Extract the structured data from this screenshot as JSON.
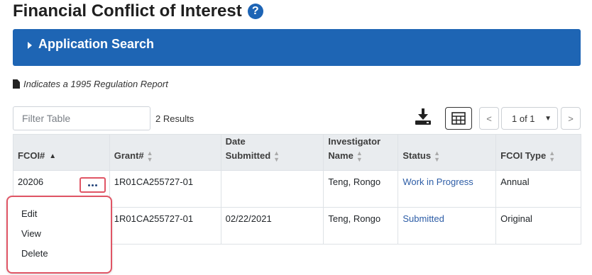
{
  "page": {
    "title": "Financial Conflict of Interest",
    "help_icon": "question-circle-icon"
  },
  "app_search": {
    "label": "Application Search"
  },
  "note": {
    "text": "Indicates a 1995 Regulation Report",
    "icon": "document-icon"
  },
  "toolbar": {
    "filter_placeholder": "Filter Table",
    "results": "2 Results",
    "download_icon": "download-icon",
    "columns_icon": "table-grid-icon",
    "prev": "<",
    "next": ">",
    "page": "1 of 1"
  },
  "table": {
    "headers": [
      {
        "line1": "FCOI#",
        "line2": ""
      },
      {
        "line1": "Grant#",
        "line2": ""
      },
      {
        "line1": "Date",
        "line2": "Submitted"
      },
      {
        "line1": "Investigator",
        "line2": "Name"
      },
      {
        "line1": "Status",
        "line2": ""
      },
      {
        "line1": "FCOI Type",
        "line2": ""
      }
    ],
    "rows": [
      {
        "fcoi": "20206",
        "grant": "1R01CA255727-01",
        "date": "",
        "investigator": "Teng, Rongo",
        "status": "Work in Progress",
        "type": "Annual"
      },
      {
        "fcoi": "",
        "grant": "1R01CA255727-01",
        "date": "02/22/2021",
        "investigator": "Teng, Rongo",
        "status": "Submitted",
        "type": "Original"
      }
    ]
  },
  "actions_menu": {
    "items": [
      "Edit",
      "View",
      "Delete"
    ]
  },
  "colors": {
    "primary": "#1e65b4",
    "link": "#2d5da6",
    "highlight": "#e05565",
    "header_bg": "#e9ecef"
  }
}
